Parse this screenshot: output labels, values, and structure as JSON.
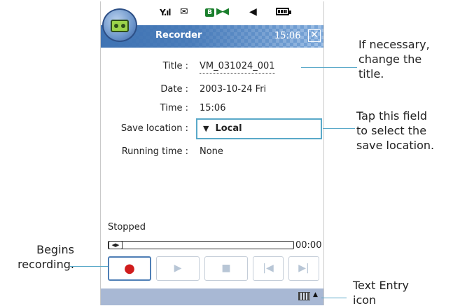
{
  "status_bar": {
    "signal": "Y.ıl",
    "mail": "✉",
    "b_badge": "B",
    "bluetooth": "▶◀",
    "volume": "◀",
    "battery": "battery-icon"
  },
  "titlebar": {
    "title": "Recorder",
    "time": "15:06",
    "close": "✕"
  },
  "form": {
    "title_label": "Title :",
    "title_value": "VM_031024_001",
    "date_label": "Date :",
    "date_value": "2003-10-24 Fri",
    "time_label": "Time :",
    "time_value": "15:06",
    "save_label": "Save location :",
    "save_value": "Local",
    "running_label": "Running time :",
    "running_value": "None"
  },
  "player": {
    "status": "Stopped",
    "elapsed": "00:00",
    "thumb": "◀▶",
    "controls": {
      "record": "●",
      "play": "▶",
      "stop": "■",
      "prev": "|◀",
      "next": "▶|"
    }
  },
  "bottom": {
    "arrow": "▲"
  },
  "callouts": {
    "title_note": [
      "If necessary,",
      "change the",
      "title."
    ],
    "save_note": [
      "Tap this field",
      "to select the",
      "save location."
    ],
    "record_note": [
      "Begins",
      "recording."
    ],
    "text_entry_note": [
      "Text Entry",
      "icon"
    ]
  },
  "colors": {
    "accent_line": "#5aa9c9",
    "titlebar": "#3f73b3",
    "record_red": "#d01c1c",
    "bottom_bar": "#a8b8d4"
  }
}
